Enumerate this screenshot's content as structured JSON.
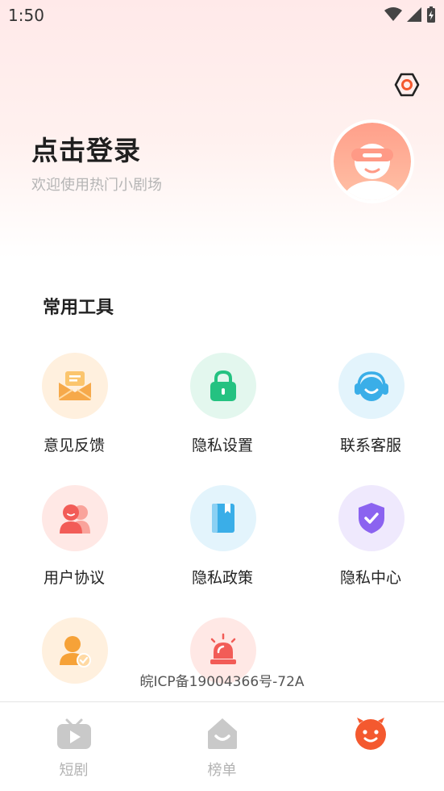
{
  "status_bar": {
    "time": "1:50"
  },
  "header": {
    "login_title": "点击登录",
    "login_subtitle": "欢迎使用热门小剧场"
  },
  "tools": {
    "section_title": "常用工具",
    "items": [
      {
        "label": "意见反馈",
        "icon": "feedback-envelope-icon",
        "bg": "#fff0de",
        "color": "#f6a94a"
      },
      {
        "label": "隐私设置",
        "icon": "lock-icon",
        "bg": "#e3f7ee",
        "color": "#24c281"
      },
      {
        "label": "联系客服",
        "icon": "headset-icon",
        "bg": "#e3f4fc",
        "color": "#3aaee8"
      },
      {
        "label": "用户协议",
        "icon": "users-icon",
        "bg": "#ffe8e5",
        "color": "#f25c57"
      },
      {
        "label": "隐私政策",
        "icon": "book-icon",
        "bg": "#e3f4fc",
        "color": "#3aaee8"
      },
      {
        "label": "隐私中心",
        "icon": "shield-check-icon",
        "bg": "#efe9fd",
        "color": "#8b63f0"
      },
      {
        "label": "",
        "icon": "user-verified-icon",
        "bg": "#fff0de",
        "color": "#f6a238"
      },
      {
        "label": "",
        "icon": "alarm-siren-icon",
        "bg": "#ffe8e5",
        "color": "#f25c57"
      }
    ]
  },
  "icp_text": "皖ICP备19004366号-72A",
  "bottom_nav": {
    "items": [
      {
        "label": "短剧",
        "icon": "tv-play-icon"
      },
      {
        "label": "榜单",
        "icon": "house-smile-icon"
      },
      {
        "label": "",
        "icon": "profile-smile-icon",
        "active": true
      }
    ],
    "active_color": "#f4592f"
  }
}
